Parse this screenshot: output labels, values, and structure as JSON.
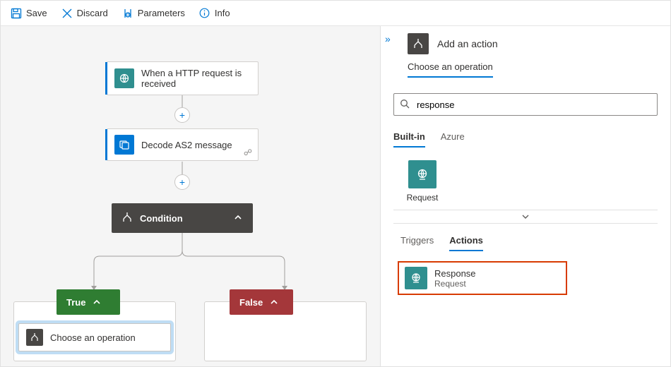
{
  "toolbar": {
    "save": "Save",
    "discard": "Discard",
    "parameters": "Parameters",
    "info": "Info"
  },
  "canvas": {
    "trigger": {
      "label": "When a HTTP request is received"
    },
    "action1": {
      "label": "Decode AS2 message"
    },
    "condition": {
      "label": "Condition"
    },
    "branches": {
      "true_label": "True",
      "false_label": "False"
    },
    "choose_op": "Choose an operation"
  },
  "panel": {
    "header": "Add an action",
    "section": "Choose an operation",
    "search_value": "response",
    "source_tabs": {
      "builtin": "Built-in",
      "azure": "Azure"
    },
    "connector": {
      "name": "Request"
    },
    "detail_tabs": {
      "triggers": "Triggers",
      "actions": "Actions"
    },
    "result": {
      "title": "Response",
      "subtitle": "Request"
    }
  }
}
